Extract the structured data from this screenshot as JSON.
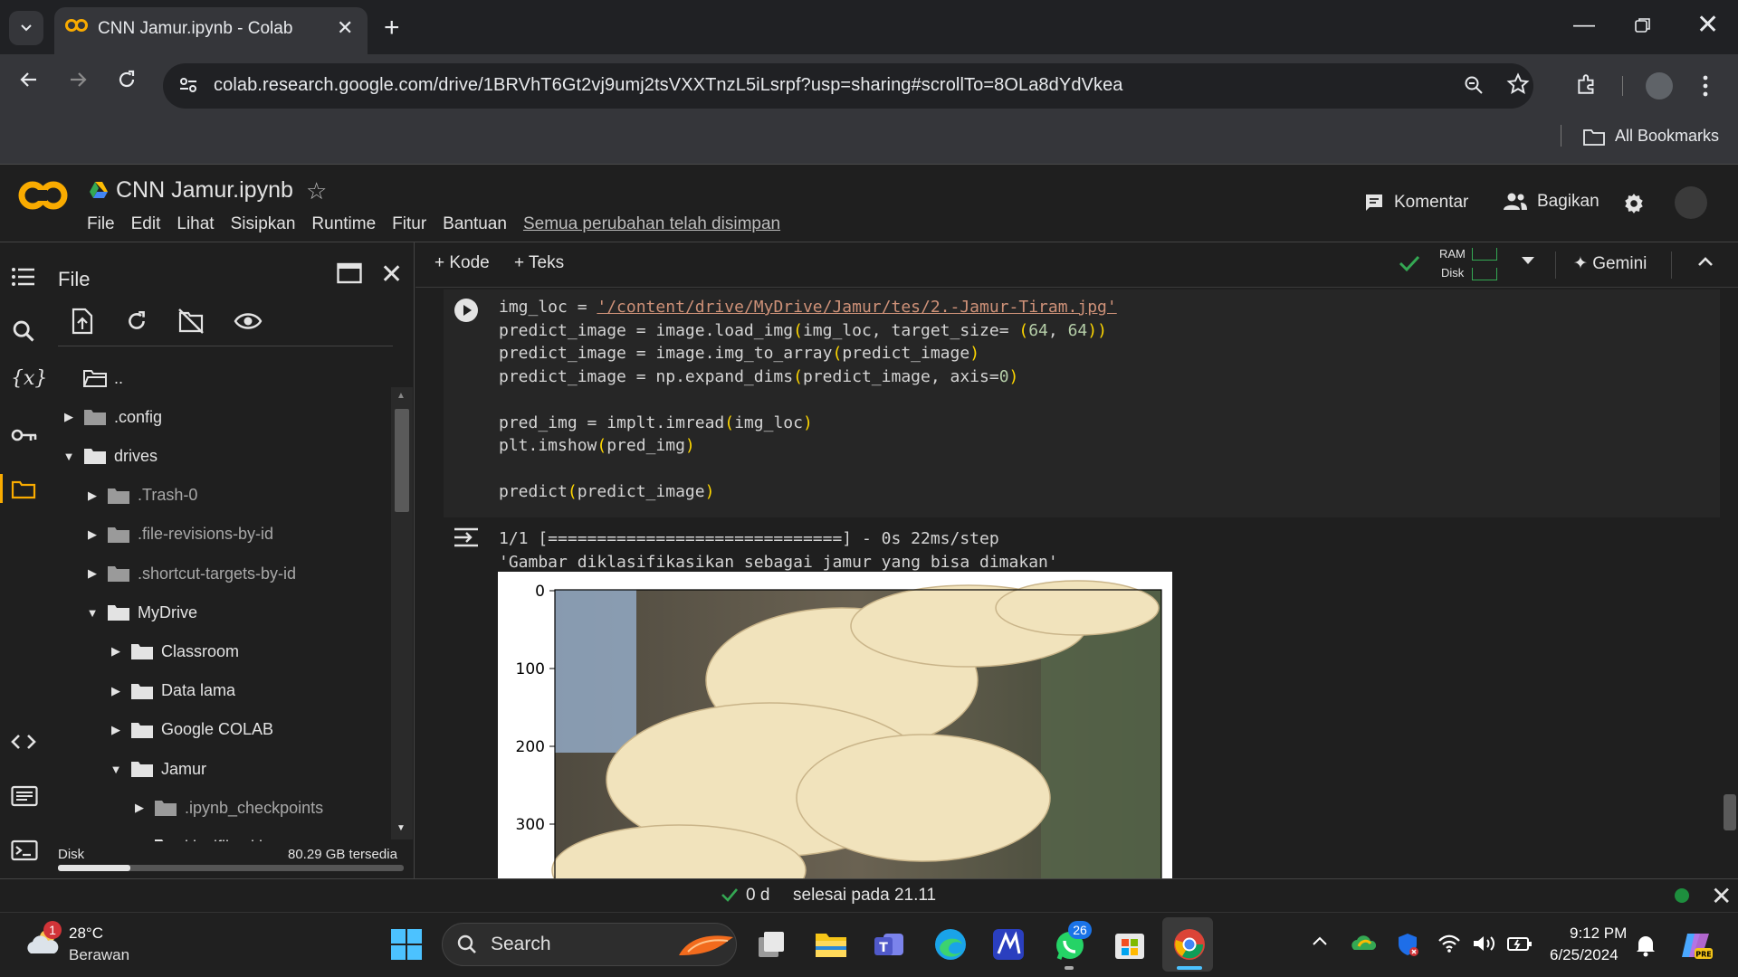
{
  "browser": {
    "tab_title": "CNN Jamur.ipynb - Colab",
    "url": "colab.research.google.com/drive/1BRVhT6Gt2vj9umj2tsVXXTnzL5iLsrpf?usp=sharing#scrollTo=8OLa8dYdVkea",
    "bookmarks_label": "All Bookmarks"
  },
  "colab": {
    "notebook_title": "CNN Jamur.ipynb",
    "menu": [
      "File",
      "Edit",
      "Lihat",
      "Sisipkan",
      "Runtime",
      "Fitur",
      "Bantuan"
    ],
    "saved_status": "Semua perubahan telah disimpan",
    "comment_label": "Komentar",
    "share_label": "Bagikan"
  },
  "file_panel": {
    "title": "File",
    "tree": [
      {
        "label": "..",
        "depth": 0,
        "caret": "none"
      },
      {
        "label": ".config",
        "depth": 0,
        "caret": "right"
      },
      {
        "label": "drives",
        "depth": 0,
        "caret": "down"
      },
      {
        "label": ".Trash-0",
        "depth": 1,
        "caret": "right"
      },
      {
        "label": ".file-revisions-by-id",
        "depth": 1,
        "caret": "right"
      },
      {
        "label": ".shortcut-targets-by-id",
        "depth": 1,
        "caret": "right"
      },
      {
        "label": "MyDrive",
        "depth": 1,
        "caret": "down"
      },
      {
        "label": "Classroom",
        "depth": 2,
        "caret": "right"
      },
      {
        "label": "Data lama",
        "depth": 2,
        "caret": "right"
      },
      {
        "label": "Google COLAB",
        "depth": 2,
        "caret": "right"
      },
      {
        "label": "Jamur",
        "depth": 2,
        "caret": "down"
      },
      {
        "label": ".ipynb_checkpoints",
        "depth": 3,
        "caret": "right"
      },
      {
        "label": "klasifikasi jamur",
        "depth": 3,
        "caret": "down"
      }
    ],
    "disk_label": "Disk",
    "disk_free": "80.29 GB tersedia",
    "disk_used_fraction": 0.21
  },
  "notebook_toolbar": {
    "add_code": "+ Kode",
    "add_text": "+ Teks",
    "ram_label": "RAM",
    "disk_label": "Disk",
    "gemini_label": "Gemini"
  },
  "cell": {
    "img_path": "'/content/drive/MyDrive/Jamur/tes/2.-Jamur-Tiram.jpg'",
    "lines": [
      "img_loc = ",
      "predict_image = image.load_img(img_loc, target_size= (64, 64))",
      "predict_image = image.img_to_array(predict_image)",
      "predict_image = np.expand_dims(predict_image, axis=0)",
      "",
      "pred_img = implt.imread(img_loc)",
      "plt.imshow(pred_img)",
      "",
      "predict(predict_image)"
    ],
    "output_progress": "1/1 [==============================] - 0s 22ms/step",
    "output_result": "'Gambar diklasifikasikan sebagai jamur yang bisa dimakan'",
    "plot_yticks": [
      "0",
      "100",
      "200",
      "300"
    ]
  },
  "status_bar": {
    "elapsed": "0 d",
    "finished": "selesai pada 21.11"
  },
  "taskbar": {
    "temperature": "28°C",
    "weather": "Berawan",
    "weather_badge": "1",
    "search_label": "Search",
    "whatsapp_badge": "26",
    "time": "9:12 PM",
    "date": "6/25/2024"
  }
}
